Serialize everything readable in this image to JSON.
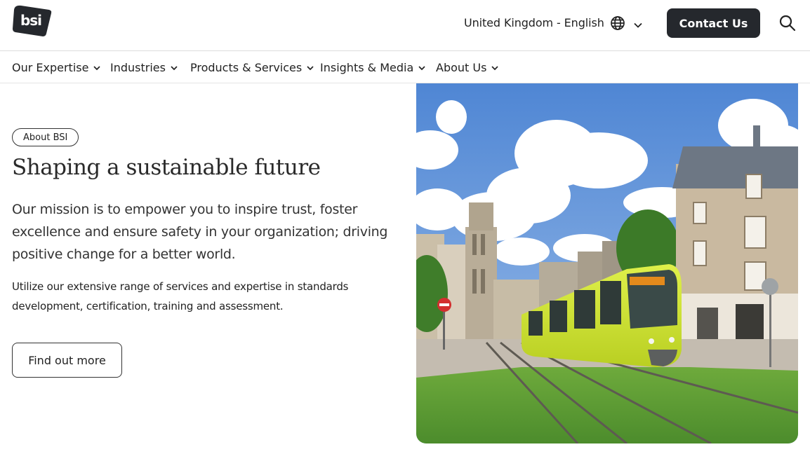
{
  "header": {
    "logo_text": "bsi",
    "locale_label": "United Kingdom - English",
    "contact_label": "Contact Us",
    "icons": {
      "globe": "globe-icon",
      "chevron": "chevron-down-icon",
      "search": "search-icon"
    }
  },
  "nav": {
    "items": [
      {
        "label": "Our Expertise"
      },
      {
        "label": "Industries"
      },
      {
        "label": "Products & Services"
      },
      {
        "label": "Insights & Media"
      },
      {
        "label": "About Us"
      }
    ]
  },
  "hero": {
    "tag": "About BSI",
    "title": "Shaping a sustainable future",
    "lead": "Our mission is to empower you to inspire trust, foster excellence and ensure safety in your organization; driving positive change for a better world.",
    "body": "Utilize our extensive range of services and expertise in standards development, certification, training and assessment.",
    "cta_label": "Find out more",
    "image_subject": "tram-city-street-photo"
  },
  "colors": {
    "brand_dark": "#25282d",
    "tram_yellow": "#c8dc2a",
    "sky": "#5f95d8",
    "grass": "#5a9a34"
  }
}
